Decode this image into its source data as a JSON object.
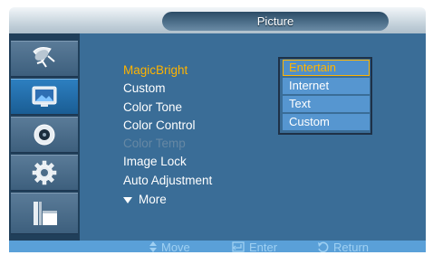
{
  "window": {
    "title": "Picture"
  },
  "sidebar": {
    "items": [
      {
        "icon": "satellite-dish-icon"
      },
      {
        "icon": "picture-icon",
        "active": true
      },
      {
        "icon": "speaker-icon"
      },
      {
        "icon": "gear-icon"
      },
      {
        "icon": "multiscreen-icon"
      }
    ]
  },
  "menu": {
    "items": [
      {
        "label": "MagicBright",
        "state": "selected"
      },
      {
        "label": "Custom"
      },
      {
        "label": "Color Tone"
      },
      {
        "label": "Color Control"
      },
      {
        "label": "Color Temp",
        "state": "disabled"
      },
      {
        "label": "Image Lock"
      },
      {
        "label": "Auto Adjustment"
      }
    ],
    "more_label": "More"
  },
  "dropdown": {
    "options": [
      "Entertain",
      "Internet",
      "Text",
      "Custom"
    ],
    "selected": "Entertain"
  },
  "footer": {
    "move_label": "Move",
    "enter_label": "Enter",
    "return_label": "Return"
  },
  "colors": {
    "panel": "#3a6d97",
    "sidebar": "#203f5a",
    "highlight": "#ffb400",
    "option_bg": "#5696d0",
    "footer_bar": "#5aa0d8"
  }
}
